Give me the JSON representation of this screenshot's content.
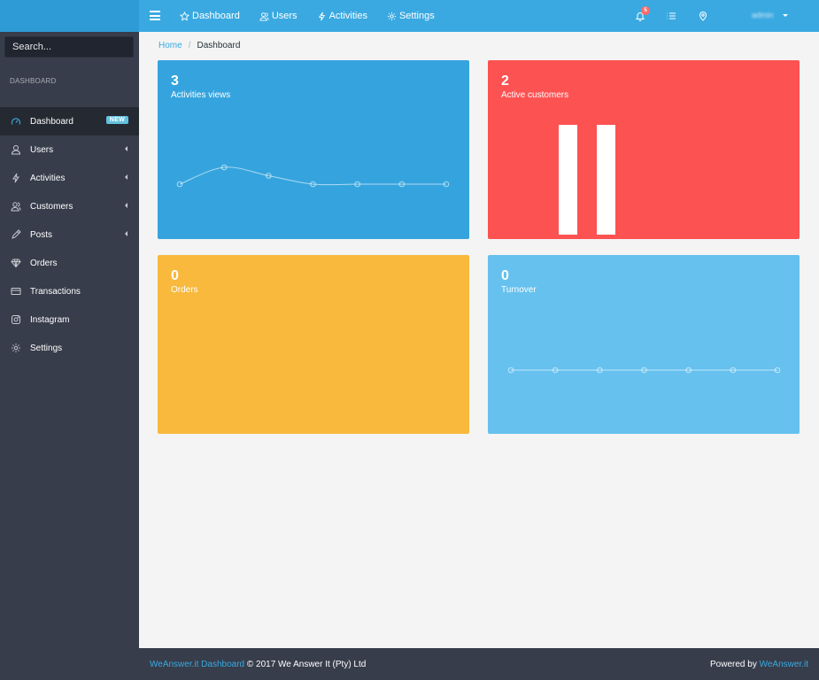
{
  "sidebar": {
    "search_placeholder": "Search...",
    "section_title": "DASHBOARD",
    "items": [
      {
        "label": "Dashboard",
        "icon": "speedometer-icon",
        "badge": "NEW",
        "active": true
      },
      {
        "label": "Users",
        "icon": "user-icon",
        "has_children": true
      },
      {
        "label": "Activities",
        "icon": "energy-icon",
        "has_children": true
      },
      {
        "label": "Customers",
        "icon": "people-icon",
        "has_children": true
      },
      {
        "label": "Posts",
        "icon": "pencil-icon",
        "has_children": true
      },
      {
        "label": "Orders",
        "icon": "diamond-icon"
      },
      {
        "label": "Transactions",
        "icon": "credit-card-icon"
      },
      {
        "label": "Instagram",
        "icon": "instagram-icon"
      },
      {
        "label": "Settings",
        "icon": "gear-icon"
      }
    ]
  },
  "header": {
    "nav": [
      {
        "label": "Dashboard",
        "icon": "star-icon"
      },
      {
        "label": "Users",
        "icon": "users-icon"
      },
      {
        "label": "Activities",
        "icon": "energy-icon"
      },
      {
        "label": "Settings",
        "icon": "gear-icon"
      }
    ],
    "notifications": "5",
    "user_name": "admin"
  },
  "breadcrumb": {
    "home": "Home",
    "current": "Dashboard"
  },
  "cards": {
    "views": {
      "value": "3",
      "label": "Activities views",
      "color": "#35a4de"
    },
    "customers": {
      "value": "2",
      "label": "Active customers",
      "color": "#fd5252"
    },
    "orders": {
      "value": "0",
      "label": "Orders",
      "color": "#f8b93c"
    },
    "turnover": {
      "value": "0",
      "label": "Turnover",
      "color": "#66c1ee"
    }
  },
  "chart_data": [
    {
      "type": "line",
      "series": [
        {
          "values": [
            0,
            1,
            0.5,
            0,
            0,
            0,
            0
          ]
        }
      ],
      "ylim": [
        0,
        1
      ],
      "grid": false
    },
    {
      "type": "bar",
      "values": [
        1,
        1
      ],
      "ylim": [
        0,
        1
      ],
      "grid": false
    },
    {
      "type": "line",
      "series": [
        {
          "values": [
            0,
            0,
            0,
            0,
            0,
            0,
            0
          ]
        }
      ],
      "ylim": [
        -1,
        1
      ],
      "grid": false
    }
  ],
  "footer": {
    "brand_link": "WeAnswer.it Dashboard",
    "copyright": "© 2017 We Answer It (Pty) Ltd",
    "powered_by": "Powered by",
    "powered_link": "WeAnswer.it"
  }
}
